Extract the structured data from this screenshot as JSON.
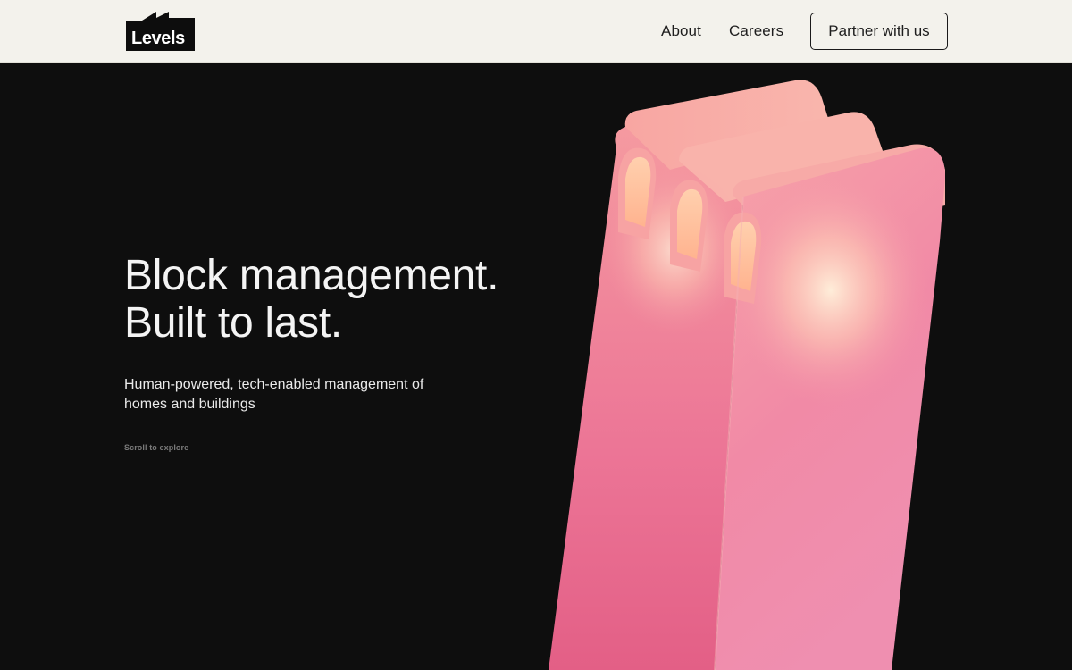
{
  "nav": {
    "logo_text": "Levels",
    "links": [
      {
        "label": "About"
      },
      {
        "label": "Careers"
      }
    ],
    "cta_label": "Partner with us"
  },
  "hero": {
    "headline_line1": "Block management.",
    "headline_line2": "Built to last.",
    "subtext": "Human-powered, tech-enabled management of homes and buildings",
    "scroll_hint": "Scroll to explore",
    "illustration": "pink-3d-building-icon"
  },
  "colors": {
    "nav_background": "#f3f2ec",
    "hero_background": "#0e0e0e",
    "headline_text": "#f4f4f4",
    "illustration_pink": "#f07a8f",
    "illustration_glow": "#ffe3c8"
  }
}
